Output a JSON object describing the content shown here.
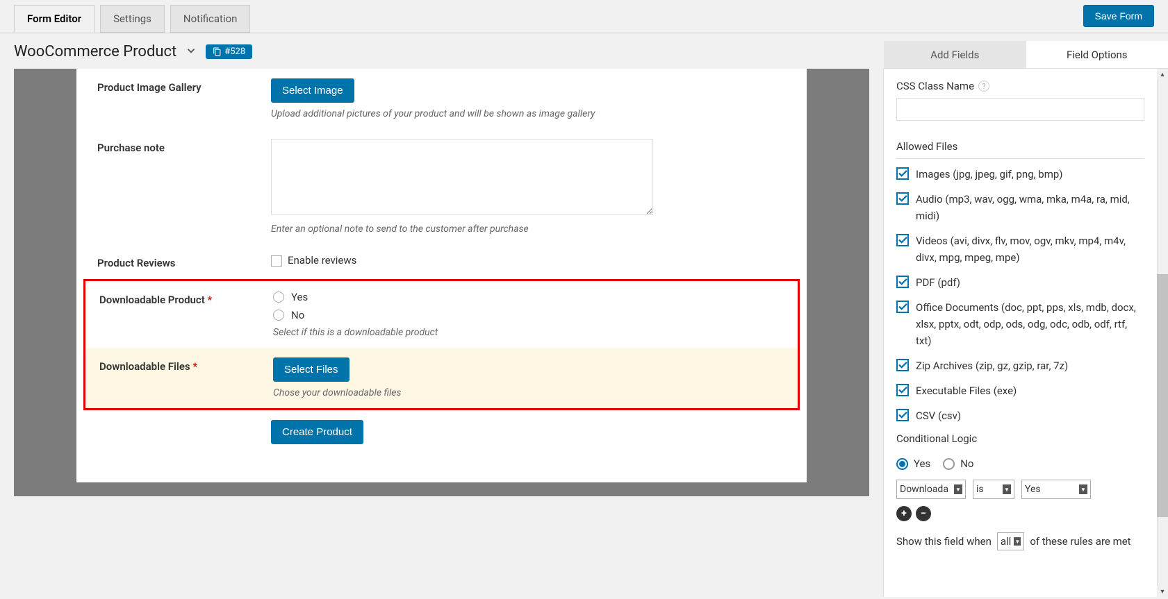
{
  "topTabs": {
    "formEditor": "Form Editor",
    "settings": "Settings",
    "notification": "Notification"
  },
  "saveForm": "Save Form",
  "formTitle": "WooCommerce Product",
  "formIdBadge": "#528",
  "fields": {
    "imageGallery": {
      "label": "Product Image Gallery",
      "button": "Select Image",
      "hint": "Upload additional pictures of your product and will be shown as image gallery"
    },
    "purchaseNote": {
      "label": "Purchase note",
      "hint": "Enter an optional note to send to the customer after purchase"
    },
    "reviews": {
      "label": "Product Reviews",
      "checkboxLabel": "Enable reviews"
    },
    "downloadable": {
      "label": "Downloadable Product",
      "yes": "Yes",
      "no": "No",
      "hint": "Select if this is a downloadable product"
    },
    "dlFiles": {
      "label": "Downloadable Files",
      "button": "Select Files",
      "hint": "Chose your downloadable files"
    },
    "submit": "Create Product"
  },
  "rightTabs": {
    "addFields": "Add Fields",
    "fieldOptions": "Field Options"
  },
  "panel": {
    "cssLabel": "CSS Class Name",
    "cssValue": "",
    "allowedTitle": "Allowed Files",
    "allowed": {
      "images": "Images (jpg, jpeg, gif, png, bmp)",
      "audio": "Audio (mp3, wav, ogg, wma, mka, m4a, ra, mid, midi)",
      "videos": "Videos (avi, divx, flv, mov, ogv, mkv, mp4, m4v, divx, mpg, mpeg, mpe)",
      "pdf": "PDF (pdf)",
      "office": "Office Documents (doc, ppt, pps, xls, mdb, docx, xlsx, pptx, odt, odp, ods, odg, odc, odb, odf, rtf, txt)",
      "zip": "Zip Archives (zip, gz, gzip, rar, 7z)",
      "exe": "Executable Files (exe)",
      "csv": "CSV (csv)"
    },
    "condTitle": "Conditional Logic",
    "condYes": "Yes",
    "condNo": "No",
    "rule": {
      "field": "Downloada",
      "op": "is",
      "value": "Yes"
    },
    "showWhenPre": "Show this field when",
    "showWhenMatch": "all",
    "showWhenPost": "of these rules are met"
  }
}
